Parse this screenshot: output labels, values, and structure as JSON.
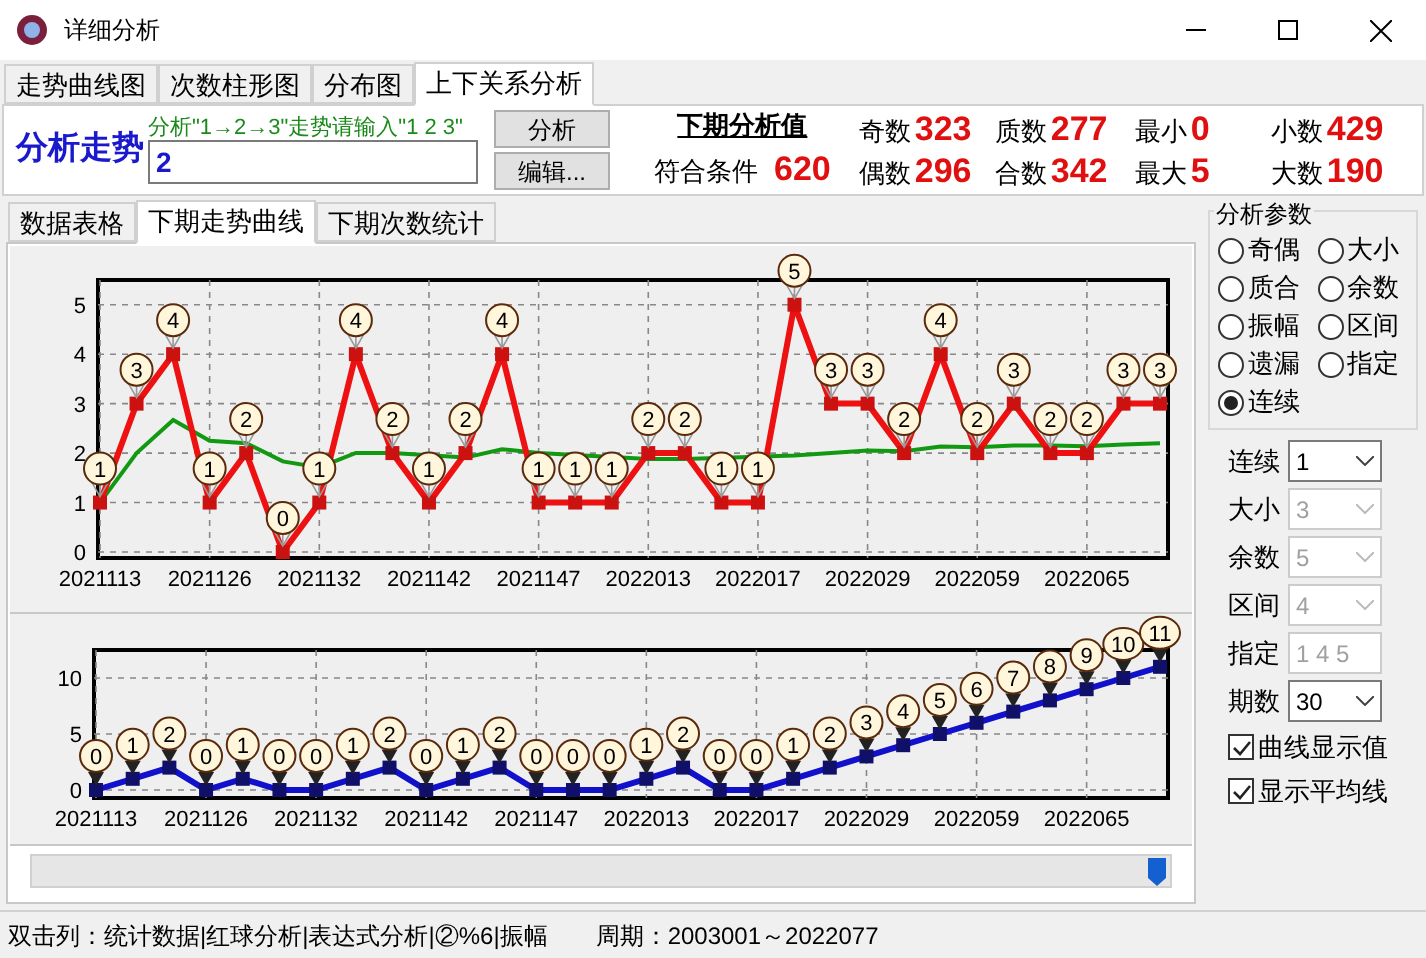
{
  "window": {
    "title": "详细分析"
  },
  "tabs": [
    {
      "label": "走势曲线图",
      "selected": false
    },
    {
      "label": "次数柱形图",
      "selected": false
    },
    {
      "label": "分布图",
      "selected": false
    },
    {
      "label": "上下关系分析",
      "selected": true
    }
  ],
  "analysis": {
    "label": "分析走势",
    "hint": "分析\"1→2→3\"走势请输入\"1 2 3\"",
    "input_value": "2",
    "buttons": [
      "分析",
      "编辑..."
    ],
    "next_title": "下期分析值",
    "match_label": "符合条件",
    "match_value": "620",
    "stats": [
      {
        "label": "奇数",
        "value": "323"
      },
      {
        "label": "质数",
        "value": "277"
      },
      {
        "label": "最小",
        "value": "0"
      },
      {
        "label": "小数",
        "value": "429"
      },
      {
        "label": "偶数",
        "value": "296"
      },
      {
        "label": "合数",
        "value": "342"
      },
      {
        "label": "最大",
        "value": "5"
      },
      {
        "label": "大数",
        "value": "190"
      }
    ]
  },
  "sub_tabs": [
    {
      "label": "数据表格",
      "selected": false
    },
    {
      "label": "下期走势曲线",
      "selected": true
    },
    {
      "label": "下期次数统计",
      "selected": false
    }
  ],
  "charts": [
    {
      "chart_data": {
        "type": "line",
        "categories": [
          "2021113",
          null,
          null,
          "2021126",
          null,
          null,
          "2021132",
          null,
          null,
          "2021142",
          null,
          null,
          "2021147",
          null,
          null,
          "2022013",
          null,
          null,
          "2022017",
          null,
          null,
          "2022029",
          null,
          null,
          "2022059",
          null,
          null,
          "2022065",
          null,
          null
        ],
        "series": [
          {
            "color": "#ee1111",
            "marker": "square",
            "values": [
              1,
              3,
              4,
              1,
              2,
              0,
              1,
              4,
              2,
              1,
              2,
              4,
              1,
              1,
              1,
              2,
              2,
              1,
              1,
              5,
              3,
              3,
              2,
              4,
              2,
              3,
              2,
              2,
              3,
              3
            ]
          },
          {
            "color": "#119911",
            "values": [
              1,
              2,
              2.67,
              2.25,
              2.2,
              1.83,
              1.71,
              2,
              2,
              null,
              1.91,
              2.08,
              2,
              null,
              null,
              1.88,
              1.88,
              null,
              null,
              1.95,
              2,
              2.05,
              2.04,
              2.13,
              2.12,
              2.15,
              2.15,
              2.14,
              2.17,
              2.2
            ]
          }
        ],
        "ylim": [
          0,
          5.5
        ],
        "yticks": [
          0,
          1,
          2,
          3,
          4,
          5
        ],
        "grid": true,
        "value_labels": [
          [
            "1",
            "3",
            "4",
            "1",
            "2",
            "0",
            "1",
            "4",
            "2",
            "1",
            "2",
            "4",
            "1",
            "1",
            "1",
            "2",
            "2",
            "1",
            "1",
            "5",
            "3",
            "3",
            "2",
            "4",
            "2",
            "3",
            "2",
            "2",
            "3",
            "3"
          ],
          [
            null,
            null,
            null,
            null,
            null,
            null,
            null,
            null,
            null,
            null,
            null,
            null,
            null,
            null,
            null,
            null,
            null,
            null,
            null,
            null,
            null,
            null,
            null,
            null,
            null,
            null,
            null,
            null,
            null,
            null
          ]
        ]
      }
    },
    {
      "chart_data": {
        "type": "line",
        "categories": [
          "2021113",
          null,
          null,
          "2021126",
          null,
          null,
          "2021132",
          null,
          null,
          "2021142",
          null,
          null,
          "2021147",
          null,
          null,
          "2022013",
          null,
          null,
          "2022017",
          null,
          null,
          "2022029",
          null,
          null,
          "2022059",
          null,
          null,
          "2022065",
          null,
          null
        ],
        "series": [
          {
            "color": "#1111cc",
            "marker": "square",
            "values": [
              0,
              1,
              2,
              0,
              1,
              0,
              0,
              1,
              2,
              0,
              1,
              2,
              0,
              0,
              0,
              1,
              2,
              0,
              0,
              1,
              2,
              3,
              4,
              5,
              6,
              7,
              8,
              9,
              10,
              11
            ]
          }
        ],
        "ylim": [
          0,
          12.5
        ],
        "yticks": [
          0,
          5,
          10
        ],
        "grid": true,
        "value_labels": [
          [
            "0",
            "1",
            "2",
            "0",
            "1",
            "0",
            "0",
            "1",
            "2",
            "0",
            "1",
            "2",
            "0",
            "0",
            "0",
            "1",
            "2",
            "0",
            "0",
            "1",
            "2",
            "3",
            "4",
            "5",
            "6",
            "7",
            "8",
            "9",
            "10",
            "11"
          ]
        ]
      }
    }
  ],
  "params": {
    "title": "分析参数",
    "radios": [
      {
        "label": "奇偶",
        "selected": false
      },
      {
        "label": "大小",
        "selected": false
      },
      {
        "label": "质合",
        "selected": false
      },
      {
        "label": "余数",
        "selected": false
      },
      {
        "label": "振幅",
        "selected": false
      },
      {
        "label": "区间",
        "selected": false
      },
      {
        "label": "遗漏",
        "selected": false
      },
      {
        "label": "指定",
        "selected": false
      },
      {
        "label": "连续",
        "selected": true
      }
    ],
    "fields": [
      {
        "label": "连续",
        "value": "1",
        "kind": "select",
        "disabled": false
      },
      {
        "label": "大小",
        "value": "3",
        "kind": "select",
        "disabled": true
      },
      {
        "label": "余数",
        "value": "5",
        "kind": "select",
        "disabled": true
      },
      {
        "label": "区间",
        "value": "4",
        "kind": "select",
        "disabled": true
      },
      {
        "label": "指定",
        "value": "1 4 5",
        "kind": "text",
        "disabled": true
      },
      {
        "label": "期数",
        "value": "30",
        "kind": "select",
        "disabled": false
      }
    ],
    "checkboxes": [
      {
        "label": "曲线显示值",
        "checked": true
      },
      {
        "label": "显示平均线",
        "checked": true
      }
    ]
  },
  "status_bar": {
    "items": [
      "双击列：统计数据|红球分析|表达式分析|②%6|振幅",
      "周期：2003001～2022077"
    ]
  }
}
